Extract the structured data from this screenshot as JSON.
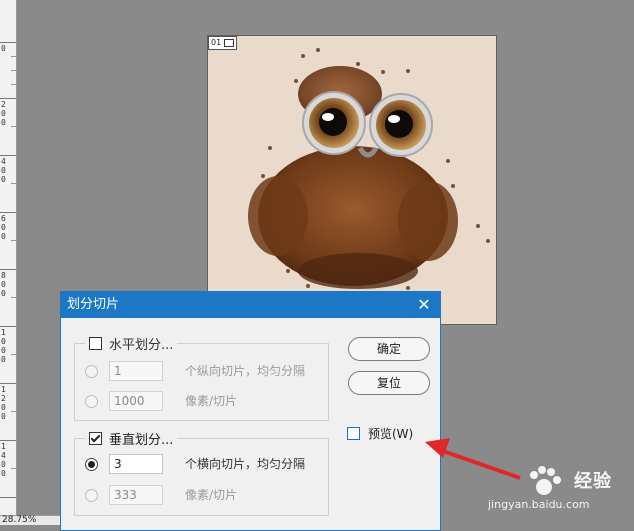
{
  "ruler": {
    "labels": [
      "0",
      "2\n0\n0",
      "4\n0\n0",
      "6\n0\n0",
      "8\n0\n0",
      "1\n0\n0\n0",
      "1\n2\n0\n0",
      "1\n4\n0\n0"
    ]
  },
  "status": {
    "zoom": "28.75%"
  },
  "document": {
    "slice_number": "01"
  },
  "dialog": {
    "title": "划分切片",
    "close_label": "✕",
    "horizontal": {
      "label": "水平划分...",
      "checked": false,
      "count_value": "1",
      "count_desc": "个纵向切片，均匀分隔",
      "pixel_value": "1000",
      "pixel_desc": "像素/切片"
    },
    "vertical": {
      "label": "垂直划分...",
      "checked": true,
      "count_value": "3",
      "count_desc": "个横向切片，均匀分隔",
      "pixel_value": "333",
      "pixel_desc": "像素/切片"
    },
    "ok_label": "确定",
    "reset_label": "复位",
    "preview_label": "预览(W)"
  },
  "watermark": {
    "brand": "经验",
    "url": "jingyan.baidu.com"
  },
  "colors": {
    "accent": "#1c78c4",
    "arrow": "#e0282a"
  }
}
